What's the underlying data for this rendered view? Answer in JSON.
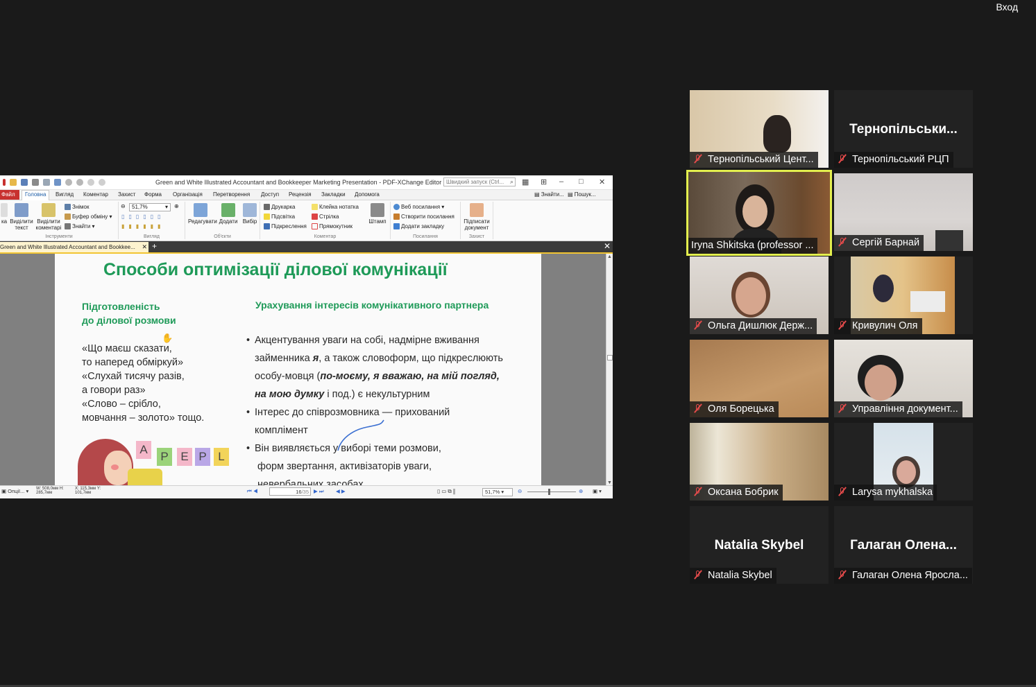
{
  "meeting": {
    "exit_label": "Вход"
  },
  "editor": {
    "window_title": "Green and White Illustrated Accountant and Bookkeeper Marketing Presentation - PDF-XChange Editor",
    "quick_search_placeholder": "Швидкий запуск (Ctrl...",
    "file_tab": "Файл",
    "menu_tabs": [
      "Головна",
      "Вигляд",
      "Коментар",
      "Захист",
      "Форма",
      "Організація",
      "Перетворення",
      "Доступ",
      "Рецензія",
      "Закладки",
      "Допомога"
    ],
    "menu_right": {
      "find": "Знайти...",
      "search": "Пошук..."
    },
    "ribbon": {
      "tools_group": "Інструменти",
      "hand_tool": "ка",
      "select_text": "Виділити текст",
      "select_comments": "Виділити коментарі",
      "snapshot": "Знімок",
      "clipboard": "Буфер обміну",
      "find": "Знайти",
      "view_group": "Вигляд",
      "zoom": "51,7%",
      "objects_group": "Об'єкти",
      "edit": "Редагувати",
      "add": "Додати",
      "select": "Вибір",
      "comment_group": "Коментар",
      "typewriter": "Друкарка",
      "highlight": "Підсвітка",
      "underline": "Підкреслення",
      "sticky_note": "Клейка нотатка",
      "arrow": "Стрілка",
      "rectangle": "Прямокутник",
      "stamp": "Штамп",
      "links_group": "Посилання",
      "web_links": "Веб посилання",
      "create_link": "Створити посилання",
      "add_bookmark": "Додати закладку",
      "protect_group": "Захист",
      "sign_document": "Підписати документ"
    },
    "doc_tab": "Green and White Illustrated Accountant and Bookkee...",
    "slide": {
      "title": "Способи оптимізації ділової комунікації",
      "left_heading_1": "Підготовленість",
      "left_heading_2": "до ділової розмови",
      "quotes": [
        "«Що маєш сказати,",
        " то наперед обміркуй»",
        "«Слухай тисячу разів,",
        " а говори раз»",
        "«Слово – срібло,",
        " мовчання – золото» тощо."
      ],
      "right_heading": "Урахування інтересів комунікативного партнера",
      "b1_l1": "Акцентування уваги на собі, надмірне вживання",
      "b1_l2a": "займенника ",
      "b1_l2b": "я",
      "b1_l2c": ", а також словоформ, що підкреслюють",
      "b1_l3a": "особу-мовця (",
      "b1_l3b": "по-моєму, я вважаю, на мій погляд,",
      "b1_l4a": "на мою думку",
      "b1_l4b": " і под.) є некультурним",
      "b2_l1": "Інтерес до співрозмовника — прихований",
      "b2_l2": "комплімент",
      "b3_l1": "Він виявляється у виборі теми розмови,",
      "b3_l2": " форм звертання, активізаторів уваги,",
      "b3_l3": " невербальних засобах",
      "letters": [
        "A",
        "P",
        "E",
        "P",
        "L"
      ]
    },
    "status": {
      "options": "Опції...",
      "dims": "W: 508,0мм H: 285,7мм",
      "coords": "X: 115,3мм Y: 101,7мм",
      "page": "16",
      "page_total": "/35",
      "zoom": "51,7%"
    }
  },
  "participants": [
    {
      "name": "Тернопільський Цент...",
      "muted": true,
      "video": true
    },
    {
      "name": "Тернопільський РЦП",
      "display": "Тернопільськи...",
      "muted": true,
      "video": false
    },
    {
      "name": "Iryna Shkitska (professor ...",
      "muted": false,
      "video": true,
      "active": true
    },
    {
      "name": "Сергій Барнай",
      "muted": true,
      "video": true
    },
    {
      "name": "Ольга Дишлюк Держ...",
      "muted": true,
      "video": true
    },
    {
      "name": "Кривулич Оля",
      "muted": true,
      "video": true
    },
    {
      "name": "Оля Борецька",
      "muted": true,
      "video": true
    },
    {
      "name": "Управління документ...",
      "muted": true,
      "video": true
    },
    {
      "name": "Оксана Бобрик",
      "muted": true,
      "video": true
    },
    {
      "name": "Larysa mykhalska",
      "muted": true,
      "video": true
    },
    {
      "name": "Natalia Skybel",
      "display": "Natalia Skybel",
      "muted": true,
      "video": false
    },
    {
      "name": "Галаган Олена Яросла...",
      "display": "Галаган  Олена...",
      "muted": true,
      "video": false
    }
  ]
}
